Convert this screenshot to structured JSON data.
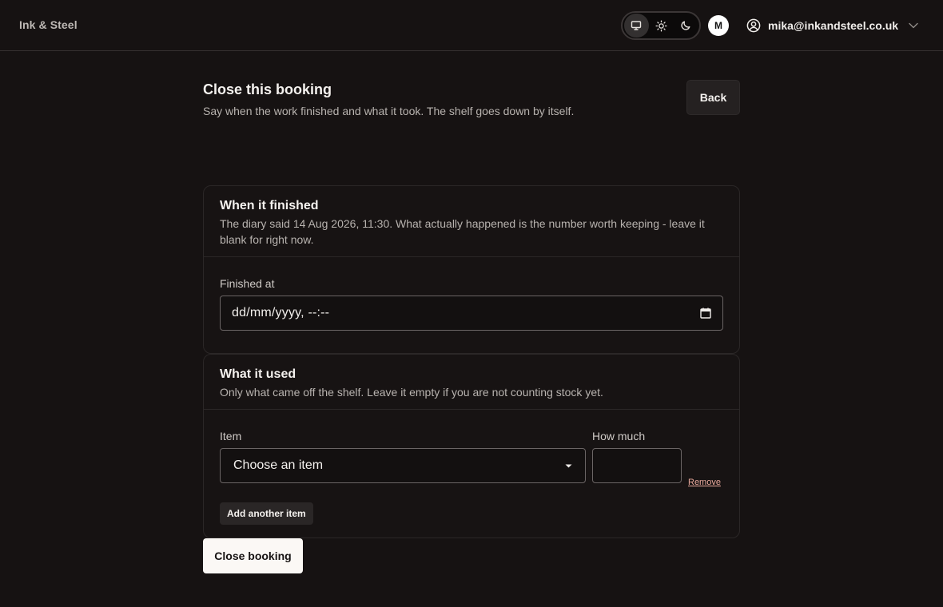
{
  "app": {
    "brand": "Ink & Steel",
    "avatar_initial": "M",
    "account_email": "mika@inkandsteel.co.uk",
    "theme_options": [
      "system",
      "light",
      "dark"
    ],
    "theme_selected": "system"
  },
  "page": {
    "title": "Close this booking",
    "subtitle": "Say when the work finished and what it took. The shelf goes down by itself.",
    "back_label": "Back"
  },
  "finished": {
    "title": "When it finished",
    "description": "The diary said 14 Aug 2026, 11:30. What actually happened is the number worth keeping - leave it blank for right now.",
    "field_label": "Finished at",
    "placeholder": "dd/mm/yyyy, --:--"
  },
  "used": {
    "title": "What it used",
    "description": "Only what came off the shelf. Leave it empty if you are not counting stock yet.",
    "item_label": "Item",
    "quantity_label": "How much",
    "item_selected": "Choose an item",
    "quantity_value": "",
    "remove_label": "Remove",
    "add_label": "Add another item"
  },
  "actions": {
    "close_label": "Close booking"
  },
  "colors": {
    "background": "#161212",
    "card_border": "#2b2727",
    "input_border": "#6b6565",
    "link": "#e9a99c",
    "primary_button": "#fbf8f5"
  }
}
